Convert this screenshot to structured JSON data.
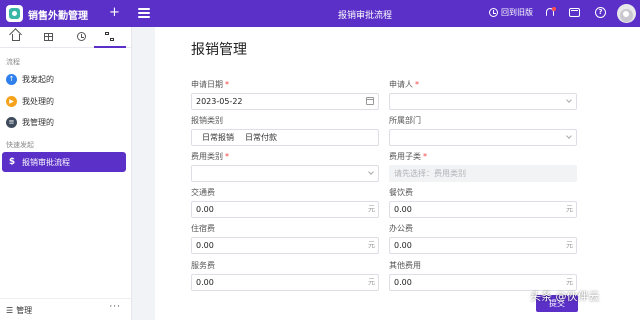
{
  "topbar": {
    "app_title": "销售外勤管理",
    "add_icon_glyph": "+",
    "page_title": "报销审批流程",
    "return_label": "回到旧版",
    "help_glyph": "?"
  },
  "sidebar": {
    "tabs": [
      "home",
      "grid",
      "recent",
      "flow"
    ],
    "flow_section": "流程",
    "items": [
      {
        "label": "我发起的",
        "icon": "arrow-up-icon",
        "glyph": "↑",
        "color": "#2f80ed"
      },
      {
        "label": "我处理的",
        "icon": "play-icon",
        "glyph": "▶",
        "color": "#f7a21b"
      },
      {
        "label": "我管理的",
        "icon": "list-icon",
        "glyph": "≡",
        "color": "#3d4b5c"
      }
    ],
    "quick_section": "快速发起",
    "active_item": {
      "label": "报销审批流程",
      "glyph": "$"
    },
    "footer_label": "管理",
    "footer_more": "···"
  },
  "form": {
    "title": "报销管理",
    "fields": {
      "apply_date": {
        "label": "申请日期",
        "value": "2023-05-22"
      },
      "applicant": {
        "label": "申请人",
        "value": ""
      },
      "expense_type": {
        "label": "报销类别",
        "options": [
          "日常报销",
          "日常付款"
        ]
      },
      "department": {
        "label": "所属部门",
        "value": ""
      },
      "cost_category": {
        "label": "费用类别",
        "value": ""
      },
      "cost_subcategory": {
        "label": "费用子类",
        "placeholder": "请先选择：费用类别"
      },
      "transport": {
        "label": "交通费",
        "value": "0.00",
        "unit": "元"
      },
      "meals": {
        "label": "餐饮费",
        "value": "0.00",
        "unit": "元"
      },
      "lodging": {
        "label": "住宿费",
        "value": "0.00",
        "unit": "元"
      },
      "office": {
        "label": "办公费",
        "value": "0.00",
        "unit": "元"
      },
      "service": {
        "label": "服务费",
        "value": "0.00",
        "unit": "元"
      },
      "other": {
        "label": "其他费用",
        "value": "0.00",
        "unit": "元"
      }
    },
    "required_mark": "*",
    "submit_label": "提交"
  },
  "watermark": "头条 @伙伴云",
  "colors": {
    "accent": "#5b30c8",
    "required": "#f53f3f"
  }
}
